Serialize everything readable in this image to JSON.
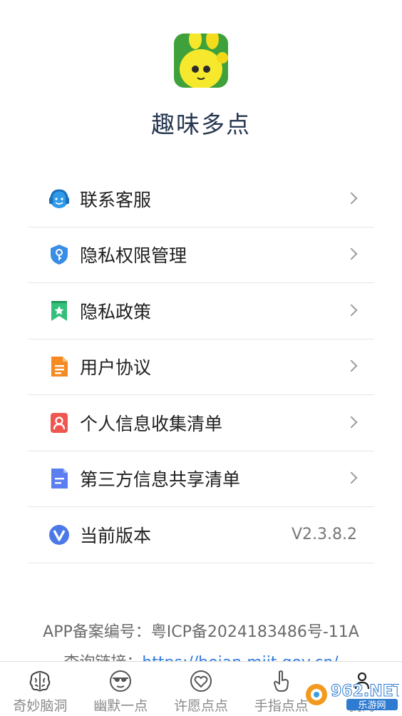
{
  "app": {
    "name": "趣味多点"
  },
  "menu": {
    "items": [
      {
        "label": "联系客服",
        "icon": "customer-service-icon"
      },
      {
        "label": "隐私权限管理",
        "icon": "shield-key-icon"
      },
      {
        "label": "隐私政策",
        "icon": "bookmark-star-icon"
      },
      {
        "label": "用户协议",
        "icon": "document-icon"
      },
      {
        "label": "个人信息收集清单",
        "icon": "person-card-icon"
      },
      {
        "label": "第三方信息共享清单",
        "icon": "list-document-icon"
      },
      {
        "label": "当前版本",
        "icon": "version-v-icon",
        "value": "V2.3.8.2"
      }
    ]
  },
  "footer": {
    "icp": "APP备案编号：粤ICP备2024183486号-11A",
    "query_label": "查询链接：",
    "query_link": "https://beian.miit.gov.cn/"
  },
  "tabbar": {
    "tabs": [
      {
        "label": "奇妙脑洞",
        "icon": "brain-icon"
      },
      {
        "label": "幽默一点",
        "icon": "sunglasses-face-icon"
      },
      {
        "label": "许愿点点",
        "icon": "heart-icon"
      },
      {
        "label": "手指点点",
        "icon": "pointing-hand-icon"
      },
      {
        "label": "我的",
        "icon": "profile-icon"
      }
    ]
  },
  "watermark": {
    "text": "962.NET",
    "subtext": "乐游网"
  },
  "colors": {
    "accent_link": "#2f7be0",
    "title": "#263650"
  }
}
